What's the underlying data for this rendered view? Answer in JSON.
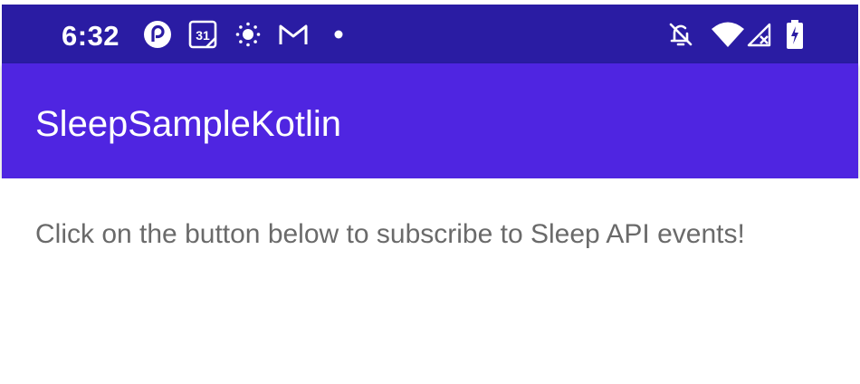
{
  "status_bar": {
    "time": "6:32",
    "calendar_day": "31",
    "icons": [
      "pocket-casts-icon",
      "calendar-icon",
      "brightness-icon",
      "gmail-icon",
      "notification-dot-icon",
      "notifications-off-icon",
      "wifi-icon",
      "cell-signal-off-icon",
      "battery-charging-icon"
    ],
    "color": "#2a1ca3"
  },
  "app_bar": {
    "title": "SleepSampleKotlin",
    "color": "#4f25e1"
  },
  "main": {
    "instruction": "Click on the button below to subscribe to Sleep API events!"
  }
}
